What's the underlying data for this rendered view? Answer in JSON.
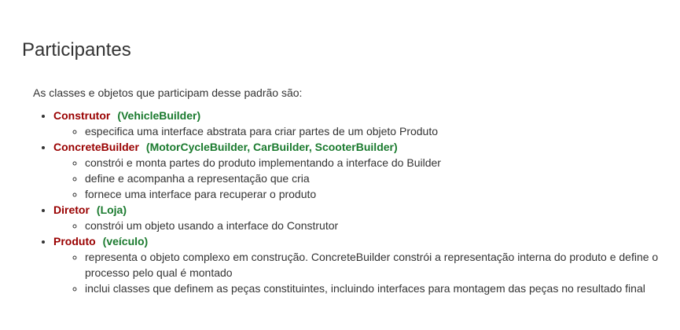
{
  "heading": "Participantes",
  "intro": "As classes e objetos que participam desse padrão são:",
  "participants": [
    {
      "name": "Construtor",
      "implementation": "(VehicleBuilder)",
      "duties": [
        "especifica uma interface abstrata para criar partes de um objeto Produto"
      ]
    },
    {
      "name": "ConcreteBuilder",
      "implementation": "(MotorCycleBuilder, CarBuilder, ScooterBuilder)",
      "duties": [
        "constrói e monta partes do produto implementando a interface do Builder",
        "define e acompanha a representação que cria",
        "fornece uma interface para recuperar o produto"
      ]
    },
    {
      "name": "Diretor",
      "implementation": "(Loja)",
      "duties": [
        "constrói um objeto usando a interface do Construtor"
      ]
    },
    {
      "name": "Produto",
      "implementation": "(veículo)",
      "duties": [
        "representa o objeto complexo em construção. ConcreteBuilder constrói a representação interna do produto e define o processo pelo qual é montado",
        "inclui classes que definem as peças constituintes, incluindo interfaces para montagem das peças no resultado final"
      ]
    }
  ]
}
